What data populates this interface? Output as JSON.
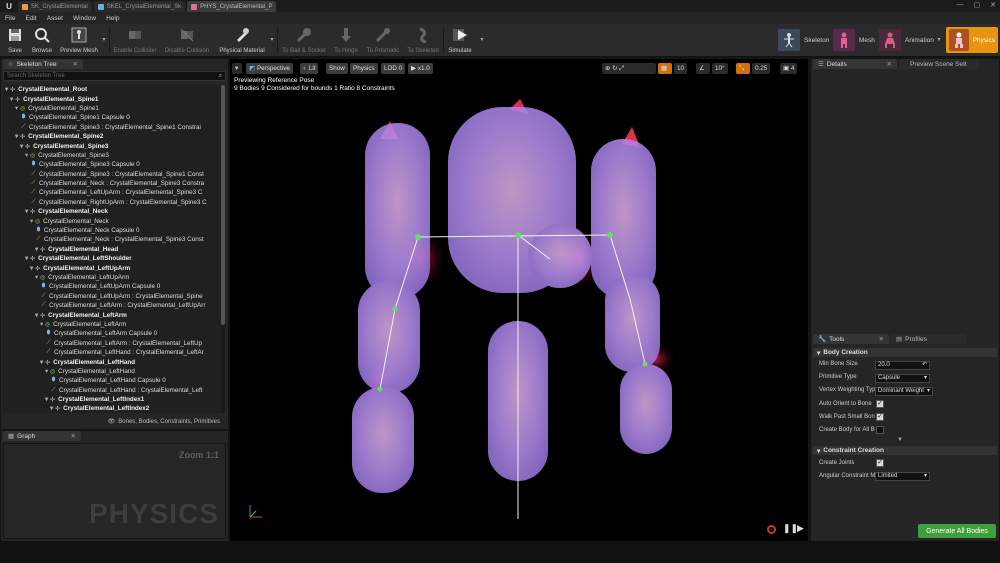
{
  "titlebar": {
    "tabs": [
      "SK_CrystalElemental",
      "SKEL_CrystalElemental_Sk",
      "PHYS_CrystalElemental_P"
    ],
    "controls": [
      "—",
      "▢",
      "✕"
    ]
  },
  "menu": [
    "File",
    "Edit",
    "Asset",
    "Window",
    "Help"
  ],
  "toolbar": {
    "buttons": [
      "Save",
      "Browse",
      "Preview Mesh",
      "Enable Collision",
      "Disable Collision",
      "Physical Material",
      "To Ball & Socket",
      "To Hinge",
      "To Prismatic",
      "To Skeleton",
      "Simulate"
    ],
    "modes": [
      "Skeleton",
      "Mesh",
      "Animation",
      "Physics"
    ]
  },
  "skeleton_tree": {
    "tab": "Skeleton Tree",
    "search_placeholder": "Search Skeleton Tree",
    "filter_label": "Bones, Bodies, Constraints, Primitives",
    "rows": [
      {
        "t": "CrystalElemental_Root",
        "lvl": 0,
        "k": "bone"
      },
      {
        "t": "CrystalElemental_Spine1",
        "lvl": 1,
        "k": "bone"
      },
      {
        "t": "CrystalElemental_Spine1",
        "lvl": 2,
        "k": "body"
      },
      {
        "t": "CrystalElemental_Spine1 Capsule 0",
        "lvl": 3,
        "k": "shape"
      },
      {
        "t": "CrystalElemental_Spine3 : CrystalElemental_Spine1 Constrai",
        "lvl": 3,
        "k": "con"
      },
      {
        "t": "CrystalElemental_Spine2",
        "lvl": 2,
        "k": "bone"
      },
      {
        "t": "CrystalElemental_Spine3",
        "lvl": 3,
        "k": "bone"
      },
      {
        "t": "CrystalElemental_Spine3",
        "lvl": 4,
        "k": "body"
      },
      {
        "t": "CrystalElemental_Spine3 Capsule 0",
        "lvl": 5,
        "k": "shape"
      },
      {
        "t": "CrystalElemental_Spine3 : CrystalElemental_Spine1 Const",
        "lvl": 5,
        "k": "con"
      },
      {
        "t": "CrystalElemental_Neck : CrystalElemental_Spine3 Constra",
        "lvl": 5,
        "k": "con"
      },
      {
        "t": "CrystalElemental_LeftUpArm : CrystalElemental_Spine3 C",
        "lvl": 5,
        "k": "con"
      },
      {
        "t": "CrystalElemental_RightUpArm : CrystalElemental_Spine3 C",
        "lvl": 5,
        "k": "con"
      },
      {
        "t": "CrystalElemental_Neck",
        "lvl": 4,
        "k": "bone"
      },
      {
        "t": "CrystalElemental_Neck",
        "lvl": 5,
        "k": "body"
      },
      {
        "t": "CrystalElemental_Neck Capsule 0",
        "lvl": 6,
        "k": "shape"
      },
      {
        "t": "CrystalElemental_Neck : CrystalElemental_Spine3 Const",
        "lvl": 6,
        "k": "con"
      },
      {
        "t": "CrystalElemental_Head",
        "lvl": 6,
        "k": "bone"
      },
      {
        "t": "CrystalElemental_LeftShoulder",
        "lvl": 4,
        "k": "bone"
      },
      {
        "t": "CrystalElemental_LeftUpArm",
        "lvl": 5,
        "k": "bone"
      },
      {
        "t": "CrystalElemental_LeftUpArm",
        "lvl": 6,
        "k": "body"
      },
      {
        "t": "CrystalElemental_LeftUpArm Capsule 0",
        "lvl": 7,
        "k": "shape"
      },
      {
        "t": "CrystalElemental_LeftUpArm : CrystalElemental_Spine",
        "lvl": 7,
        "k": "con"
      },
      {
        "t": "CrystalElemental_LeftArm : CrystalElemental_LeftUpArr",
        "lvl": 7,
        "k": "con"
      },
      {
        "t": "CrystalElemental_LeftArm",
        "lvl": 6,
        "k": "bone"
      },
      {
        "t": "CrystalElemental_LeftArm",
        "lvl": 7,
        "k": "body"
      },
      {
        "t": "CrystalElemental_LeftArm Capsule 0",
        "lvl": 8,
        "k": "shape"
      },
      {
        "t": "CrystalElemental_LeftArm : CrystalElemental_LeftUp",
        "lvl": 8,
        "k": "con"
      },
      {
        "t": "CrystalElemental_LeftHand : CrystalElemental_LeftAr",
        "lvl": 8,
        "k": "con"
      },
      {
        "t": "CrystalElemental_LeftHand",
        "lvl": 7,
        "k": "bone"
      },
      {
        "t": "CrystalElemental_LeftHand",
        "lvl": 8,
        "k": "body"
      },
      {
        "t": "CrystalElemental_LeftHand Capsule 0",
        "lvl": 9,
        "k": "shape"
      },
      {
        "t": "CrystalElemental_LeftHand : CrystalElemental_Left",
        "lvl": 9,
        "k": "con"
      },
      {
        "t": "CrystalElemental_LeftIndex1",
        "lvl": 8,
        "k": "bone"
      },
      {
        "t": "CrystalElemental_LeftIndex2",
        "lvl": 9,
        "k": "bone"
      }
    ]
  },
  "graph": {
    "tab": "Graph",
    "zoom": "Zoom 1:1",
    "watermark": "PHYSICS"
  },
  "viewport": {
    "buttons": [
      "Perspective",
      "Lit",
      "Show",
      "Physics",
      "LOD 0",
      "x1.0"
    ],
    "right_values": [
      "10",
      "10°",
      "0.25",
      "4"
    ],
    "info_line1": "Previewing Reference Pose",
    "info_line2": "9 Bodies  9 Considered for bounds  1 Ratio  8 Constraints"
  },
  "details": {
    "tab1": "Details",
    "tab2": "Preview Scene Sett"
  },
  "tools": {
    "tab1": "Tools",
    "tab2": "Profiles",
    "section1": "Body Creation",
    "section2": "Constraint Creation",
    "min_bone_size_label": "Min Bone Size",
    "min_bone_size": "20.0",
    "primitive_type_label": "Primitive Type",
    "primitive_type": "Capsule",
    "vertex_weighting_label": "Vertex Weighting Typ",
    "vertex_weighting": "Dominant Weight",
    "auto_orient_label": "Auto Orient to Bone",
    "walk_past_label": "Walk Past Small Bon",
    "create_body_label": "Create Body for All B",
    "create_joints_label": "Create Joints",
    "angular_label": "Angular Constraint M",
    "angular": "Limited",
    "generate_button": "Generate All Bodies"
  },
  "colors": {
    "accent": "#e8940f",
    "generate": "#3fa03b",
    "body": "#c9a8ff"
  }
}
